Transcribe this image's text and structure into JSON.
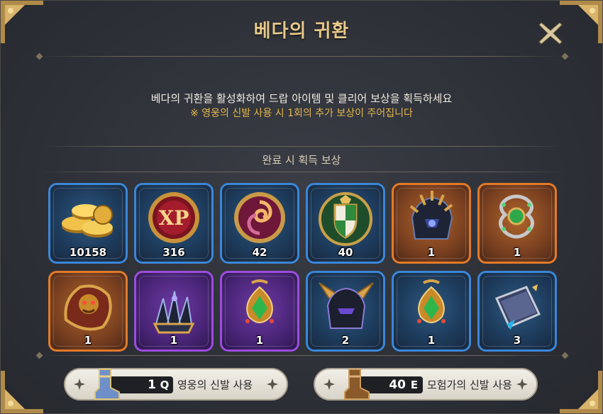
{
  "title": "베다의 귀환",
  "description": "베다의 귀환을 활성화하여 드랍 아이템 및 클리어 보상을 획득하세요",
  "note": "※ 영웅의 신발 사용 시 1회의 추가 보상이 주어집니다",
  "section_label": "완료 시 획득 보상",
  "rewards": [
    {
      "icon": "gold-coins-icon",
      "quantity": "10158",
      "rarity": "blue"
    },
    {
      "icon": "xp-medal-icon",
      "quantity": "316",
      "rarity": "blue"
    },
    {
      "icon": "swirl-rune-icon",
      "quantity": "42",
      "rarity": "blue"
    },
    {
      "icon": "shield-crest-icon",
      "quantity": "40",
      "rarity": "blue"
    },
    {
      "icon": "spiked-helmet-icon",
      "quantity": "1",
      "rarity": "orange"
    },
    {
      "icon": "emerald-amulet-icon",
      "quantity": "1",
      "rarity": "orange"
    },
    {
      "icon": "lion-pauldron-icon",
      "quantity": "1",
      "rarity": "orange"
    },
    {
      "icon": "claw-gauntlet-icon",
      "quantity": "1",
      "rarity": "purple"
    },
    {
      "icon": "green-pendant-icon",
      "quantity": "1",
      "rarity": "purple"
    },
    {
      "icon": "horned-helmet-icon",
      "quantity": "2",
      "rarity": "blue"
    },
    {
      "icon": "green-pendant-icon",
      "quantity": "1",
      "rarity": "blue"
    },
    {
      "icon": "spellbook-icon",
      "quantity": "3",
      "rarity": "blue"
    }
  ],
  "actions": [
    {
      "icon": "hero-boots-icon",
      "count": "1",
      "key": "Q",
      "label": "영웅의 신발 사용"
    },
    {
      "icon": "adventurer-boots-icon",
      "count": "40",
      "key": "E",
      "label": "모험가의 신발 사용"
    }
  ],
  "colors": {
    "blue": "#3b86d6",
    "orange": "#e07a2a",
    "purple": "#9a4ddb",
    "title": "#e8c98a",
    "note": "#e6b84b"
  }
}
